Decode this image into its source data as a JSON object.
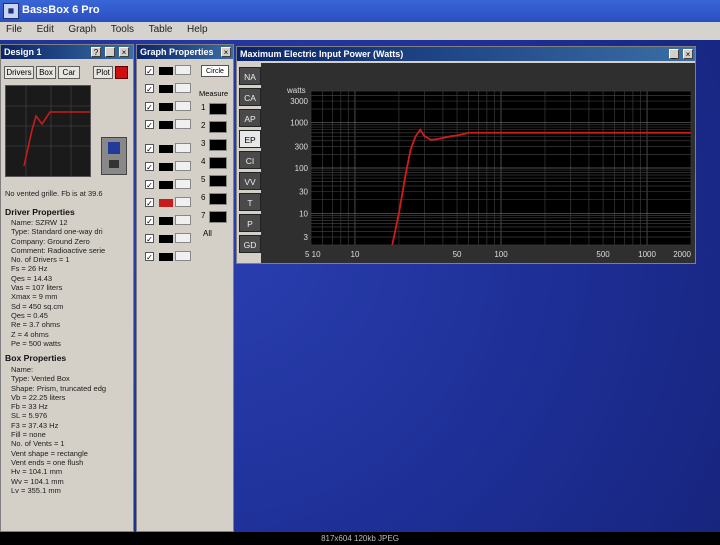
{
  "app": {
    "title": "BassBox 6 Pro",
    "menu": [
      "File",
      "Edit",
      "Graph",
      "Tools",
      "Table",
      "Help"
    ]
  },
  "design_window": {
    "title": "Design 1",
    "tabs": [
      "Drivers",
      "Box",
      "Car"
    ],
    "plot_label": "Plot",
    "note": "No vented grille. Fb is at 39.6",
    "driver_heading": "Driver Properties",
    "driver_props": [
      "Name: SZRW 12",
      "Type: Standard one-way dri",
      "Company: Ground Zero",
      "Comment: Radioactive serie",
      "No. of Drivers = 1",
      "Fs = 26 Hz",
      "Qes = 14.43",
      "Vas = 107 liters",
      "Xmax = 9 mm",
      "Sd = 450 sq.cm",
      "Qes = 0.45",
      "Re = 3.7 ohms",
      "Z = 4 ohms",
      "Pe = 500 watts"
    ],
    "box_heading": "Box Properties",
    "box_props": [
      "Name:",
      "Type: Vented Box",
      "Shape: Prism, truncated edg",
      "Vb = 22.25 liters",
      "Fb = 33 Hz",
      "SL = 5.976",
      "F3 = 37.43 Hz",
      "Fill = none",
      "No. of Vents = 1",
      "Vent shape = rectangle",
      "Vent ends = one flush",
      "Hv = 104.1 mm",
      "Wv = 104.1 mm",
      "Lv = 355.1 mm"
    ]
  },
  "graph_props": {
    "title": "Graph Properties",
    "dropdown": "Circle",
    "measure_label": "Measure",
    "markers": [
      "1",
      "2",
      "3",
      "4",
      "5",
      "6",
      "7"
    ],
    "all_label": "All"
  },
  "plot_window": {
    "title": "Maximum Electric Input Power (Watts)",
    "tabs": [
      "NA",
      "CA",
      "AP",
      "EP",
      "CI",
      "VV",
      "T",
      "P",
      "GD"
    ],
    "selected_tab": "EP"
  },
  "chart_data": {
    "type": "line",
    "title": "Maximum Electric Input Power (Watts)",
    "ylabel": "watts",
    "y_ticks": [
      "3000",
      "1000",
      "300",
      "100",
      "30",
      "10",
      "3"
    ],
    "x_ticks": [
      "5 10",
      "10",
      "50",
      "100",
      "500",
      "1000",
      "2000"
    ],
    "x_scale": "log",
    "y_scale": "log",
    "xlim": [
      5,
      2000
    ],
    "ylim": [
      2,
      5000
    ],
    "grid": true,
    "series": [
      {
        "color": "#d21c1c",
        "x": [
          18,
          20,
          22,
          24,
          26,
          28,
          30,
          33,
          36,
          40,
          45,
          50,
          55,
          60,
          80,
          100,
          200,
          500,
          1000,
          2000
        ],
        "y": [
          2,
          10,
          60,
          250,
          500,
          700,
          500,
          420,
          430,
          460,
          500,
          520,
          560,
          600,
          600,
          600,
          600,
          600,
          600,
          600
        ]
      }
    ]
  },
  "statusbar": {
    "text": "817x604  120kb  JPEG"
  }
}
